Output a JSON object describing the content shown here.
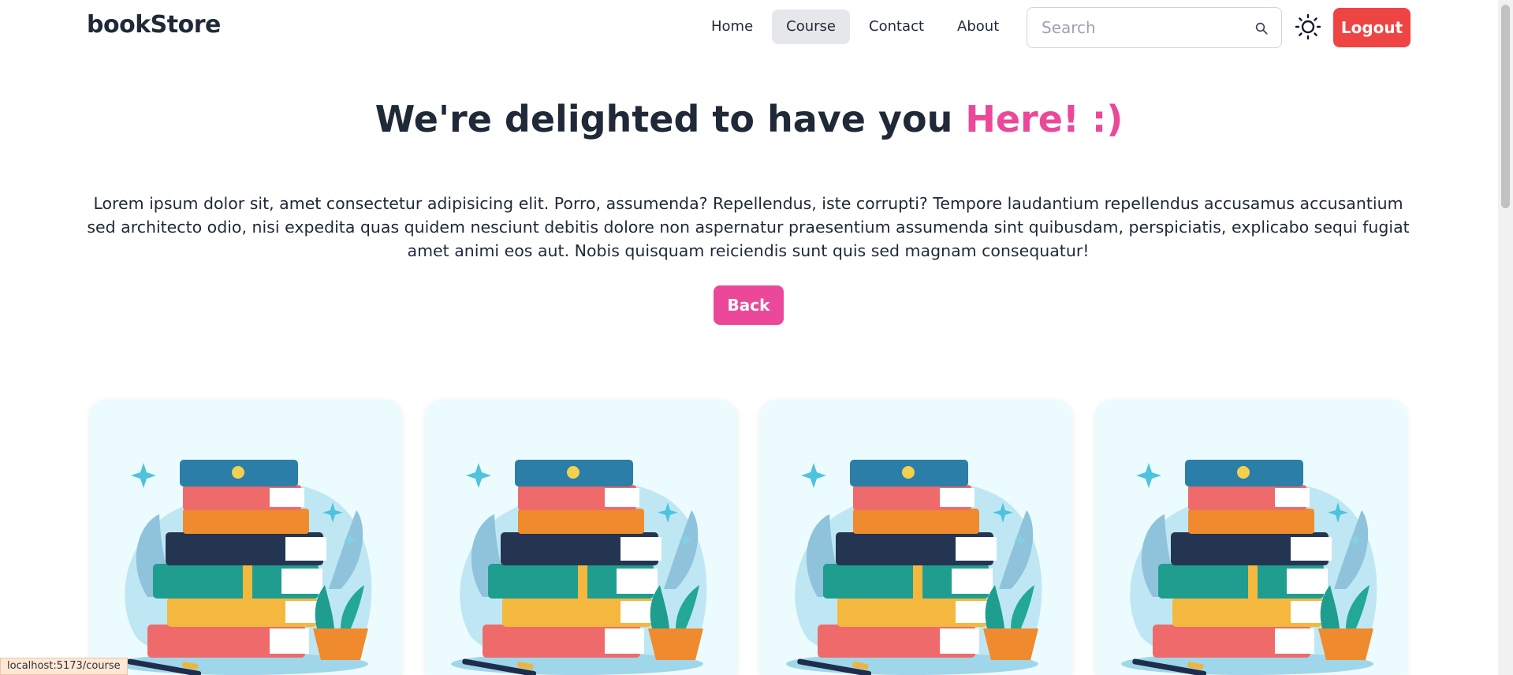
{
  "brand": {
    "name": "bookStore"
  },
  "nav": {
    "items": [
      {
        "label": "Home",
        "active": false
      },
      {
        "label": "Course",
        "active": true
      },
      {
        "label": "Contact",
        "active": false
      },
      {
        "label": "About",
        "active": false
      }
    ]
  },
  "search": {
    "placeholder": "Search",
    "value": "",
    "icon": "search-icon"
  },
  "theme_toggle": {
    "icon": "sun-icon"
  },
  "logout": {
    "label": "Logout",
    "color": "#ef4444"
  },
  "hero": {
    "title_main": "We're delighted to have you ",
    "title_accent": "Here! :)",
    "accent_color": "#ec4899",
    "text": "Lorem ipsum dolor sit, amet consectetur adipisicing elit. Porro, assumenda? Repellendus, iste corrupti? Tempore laudantium repellendus accusamus accusantium sed architecto odio, nisi expedita quas quidem nesciunt debitis dolore non aspernatur praesentium assumenda sint quibusdam, perspiciatis, explicabo sequi fugiat amet animi eos aut. Nobis quisquam reiciendis sunt quis sed magnam consequatur!"
  },
  "back_button": {
    "label": "Back"
  },
  "cards": [
    {
      "image": "books-stack-illustration"
    },
    {
      "image": "books-stack-illustration"
    },
    {
      "image": "books-stack-illustration"
    },
    {
      "image": "books-stack-illustration"
    }
  ],
  "status_bar": {
    "url": "localhost:5173/course"
  }
}
